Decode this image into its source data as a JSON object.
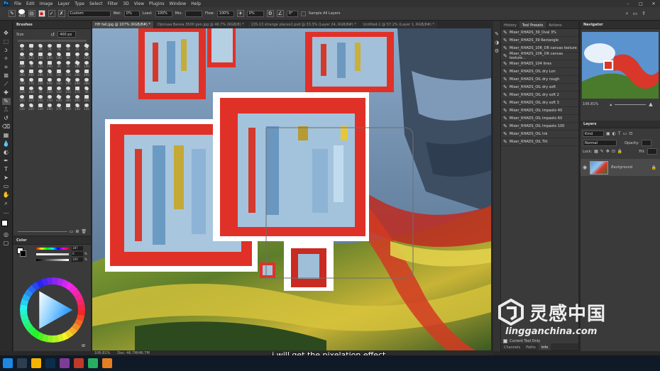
{
  "menu": [
    "File",
    "Edit",
    "Image",
    "Layer",
    "Type",
    "Select",
    "Filter",
    "3D",
    "View",
    "Plugins",
    "Window",
    "Help"
  ],
  "app_badge": "Ps",
  "options": {
    "size_value": "400",
    "preset_value": "Custom",
    "wet_label": "Wet:",
    "wet_value": "0%",
    "load_label": "Load:",
    "load_value": "100%",
    "mix_label": "Mix:",
    "flow_label": "Flow:",
    "flow_value": "100%",
    "smoothing_value": "0%",
    "angle_value": "0°",
    "sample_all_layers": "Sample All Layers"
  },
  "doc_tabs": [
    {
      "label": "HH fall.jpg @ 107% (RGB/8#) *",
      "active": true
    },
    {
      "label": "Djonsaa Banea 3500 gen.jpg @ 46.7% (RGB/8) *",
      "active": false
    },
    {
      "label": "135-13 strange places2.psd @ 33.3% (Layer 24, RGB/8#) *",
      "active": false
    },
    {
      "label": "Untitled-1 @ 57.2% (Layer 1, RGB/8#) *",
      "active": false
    }
  ],
  "brushes_panel": {
    "title": "Brushes",
    "size_label": "Size",
    "size_value": "400 px",
    "sizes": [
      "30",
      "25",
      "20",
      "70",
      "70",
      "46",
      "25",
      "60",
      "125",
      "125",
      "100",
      "100",
      "100",
      "60",
      "75",
      "120",
      "150",
      "70",
      "125",
      "200",
      "40",
      "30",
      "100",
      "100",
      "300",
      "400",
      "200",
      "175",
      "160",
      "150",
      "200",
      "400",
      "150",
      "175",
      "250",
      "600",
      "180",
      "160",
      "200",
      "300",
      "125",
      "100",
      "25",
      "200",
      "150",
      "125",
      "175",
      "50",
      "125",
      "125",
      "125",
      "150",
      "400",
      "300",
      "400",
      "300",
      "150",
      "225",
      "150",
      "200",
      "175",
      "150",
      "150",
      "125"
    ]
  },
  "color_panel": {
    "title": "Color",
    "values": [
      "187",
      "0",
      "100"
    ],
    "units": [
      "",
      "%",
      "%"
    ]
  },
  "history_tabs": [
    "History",
    "Tool Presets",
    "Actions"
  ],
  "tool_presets": [
    "Mixer_RHADS_39_Oval 3%",
    "Mixer_RHADS_39 Rectangle",
    "Mixer_RHADS_10R_OR canvas texture",
    "Mixer_RHADS_10R_OR canvas texture...",
    "Mixer_RHADS_104 lines",
    "Mixer_RHADS_OIL dry Lon",
    "Mixer_RHADS_OIL dry rough",
    "Mixer_RHADS_OIL dry soft",
    "Mixer_RHADS_OIL dry soft 2",
    "Mixer_RHADS_OIL dry soft 3",
    "Mixer_RHADS_OIL Impasto 40",
    "Mixer_RHADS_OIL Impasto 60",
    "Mixer_RHADS_OIL Impasto 100",
    "Mixer_RHADS_OIL Ink",
    "Mixer_RHADS_OIL Tilt"
  ],
  "current_tool_only": "Current Tool Only",
  "bottom_tabs": [
    "Channels",
    "Paths",
    "Info"
  ],
  "navigator": {
    "title": "Navigator",
    "zoom": "106.81%"
  },
  "layers_panel": {
    "title": "Layers",
    "filter_label": "Kind",
    "blend_mode": "Normal",
    "opacity_label": "Opacity:",
    "lock_label": "Lock:",
    "fill_label": "Fill:",
    "layer_name": "Background"
  },
  "status": {
    "zoom": "106.81%",
    "doc": "Doc: 46.7M/46.7M"
  },
  "subtitle": "i will get the pixelation effect.",
  "watermark": {
    "cn": "灵感中国",
    "url": "lingganchina.com"
  }
}
